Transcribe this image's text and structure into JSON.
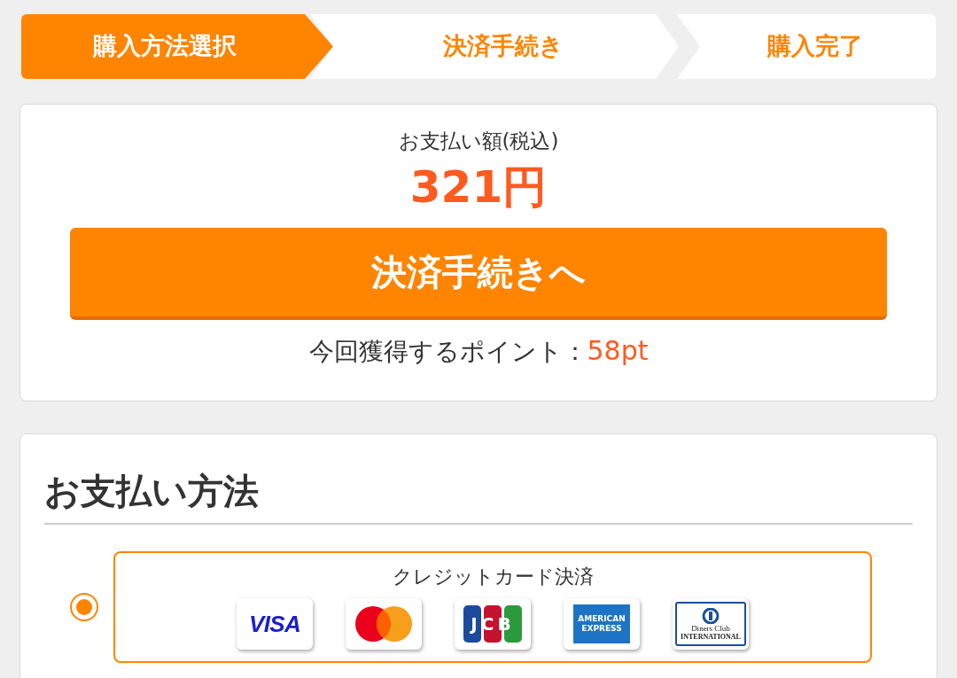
{
  "steps": [
    {
      "label": "購入方法選択",
      "selected": true
    },
    {
      "label": "決済手続き",
      "selected": false
    },
    {
      "label": "購入完了",
      "selected": false
    }
  ],
  "summary": {
    "amount_label": "お支払い額(税込)",
    "amount": "321円",
    "button": "決済手続きへ",
    "points_label": "今回獲得するポイント：",
    "points": "58pt"
  },
  "payment": {
    "title": "お支払い方法",
    "options": [
      {
        "label": "クレジットカード決済",
        "selected": true,
        "cards": [
          {
            "kind": "visa",
            "label": "VISA"
          },
          {
            "kind": "mastercard"
          },
          {
            "kind": "jcb",
            "label": "JCB"
          },
          {
            "kind": "amex",
            "label": "AMERICAN EXPRESS"
          },
          {
            "kind": "diners",
            "label": "Diners Club",
            "sublabel": "INTERNATIONAL"
          }
        ]
      }
    ]
  }
}
